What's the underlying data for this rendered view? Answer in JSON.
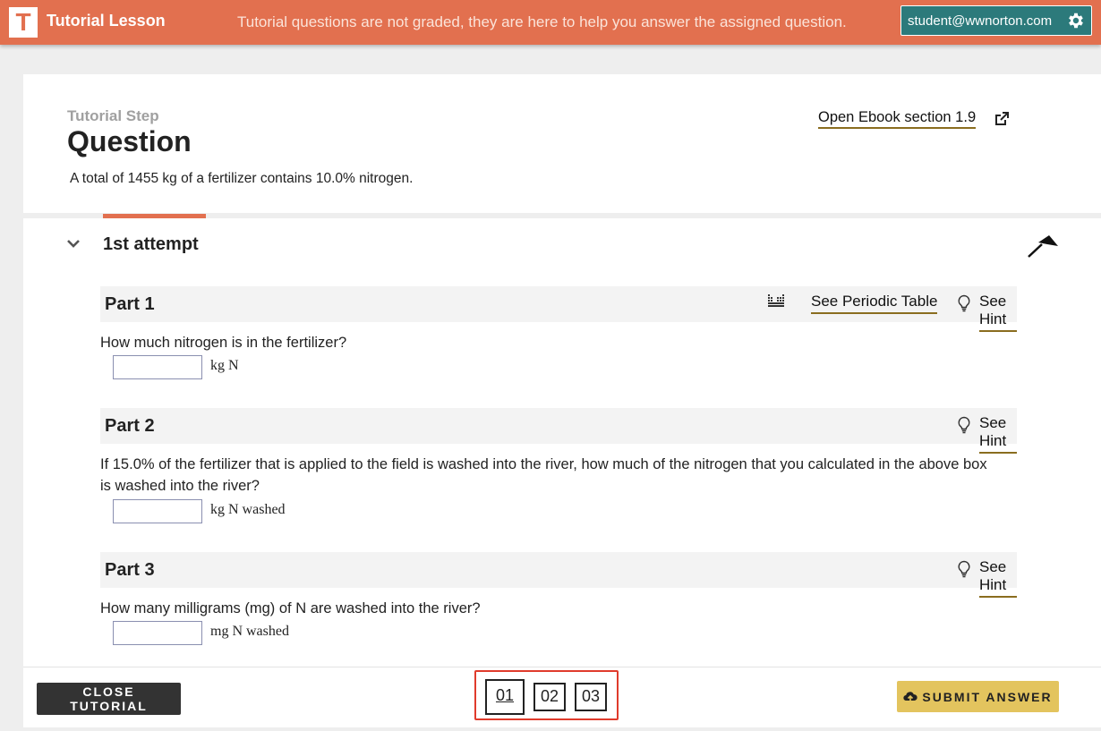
{
  "topbar": {
    "logo_letter": "T",
    "title": "Tutorial Lesson",
    "notice": "Tutorial questions are not graded, they are here to help you answer the assigned question.",
    "user_email": "student@wwnorton.com"
  },
  "header": {
    "step_label": "Tutorial Step",
    "title": "Question",
    "text": "A total of 1455  kg of a fertilizer contains 10.0% nitrogen.",
    "ebook_link": "Open Ebook section  1.9"
  },
  "attempt": {
    "title": "1st attempt"
  },
  "parts": [
    {
      "title": "Part 1",
      "periodic_table_link": "See Periodic Table",
      "hint_link": "See Hint",
      "question": "How much nitrogen is in the fertilizer?",
      "answer_value": "",
      "unit": "kg N"
    },
    {
      "title": "Part 2",
      "hint_link": "See Hint",
      "question": "If 15.0% of the fertilizer that is applied to the field is washed into the river, how much of the nitrogen that you calculated in the above box is washed into the river?",
      "answer_value": "",
      "unit": "kg N washed"
    },
    {
      "title": "Part 3",
      "hint_link": "See Hint",
      "question": "How many milligrams (mg) of N are washed into the river?",
      "answer_value": "",
      "unit": "mg N washed"
    }
  ],
  "footer": {
    "close_label": "CLOSE TUTORIAL",
    "pages": [
      "01",
      "02",
      "03"
    ],
    "current_page": "01",
    "submit_label": "SUBMIT ANSWER"
  },
  "colors": {
    "brand": "#e2704f",
    "user_button": "#2c7a7b",
    "submit": "#e3c45e",
    "pager_highlight": "#e03b2c",
    "link_underline": "#8a6d1f"
  },
  "icons": [
    "gear-icon",
    "external-link-icon",
    "chevron-down-icon",
    "pin-icon",
    "periodic-table-icon",
    "lightbulb-icon",
    "cloud-upload-icon"
  ]
}
